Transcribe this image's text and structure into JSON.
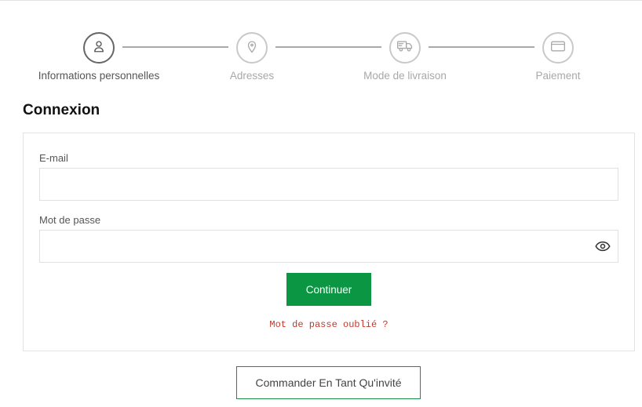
{
  "steps": [
    {
      "label": "Informations personnelles",
      "icon": "user-icon",
      "active": true
    },
    {
      "label": "Adresses",
      "icon": "map-pin-icon",
      "active": false
    },
    {
      "label": "Mode de livraison",
      "icon": "truck-icon",
      "active": false
    },
    {
      "label": "Paiement",
      "icon": "credit-card-icon",
      "active": false
    }
  ],
  "login": {
    "title": "Connexion",
    "email_label": "E-mail",
    "email_value": "",
    "password_label": "Mot de passe",
    "password_value": "",
    "submit_label": "Continuer",
    "forgot_link": "Mot de passe oublié ?"
  },
  "guest_button": "Commander En Tant Qu'invité",
  "colors": {
    "primary_green": "#0a9642",
    "guest_border": "#1e8a4a",
    "forgot_link": "#c0392b"
  }
}
